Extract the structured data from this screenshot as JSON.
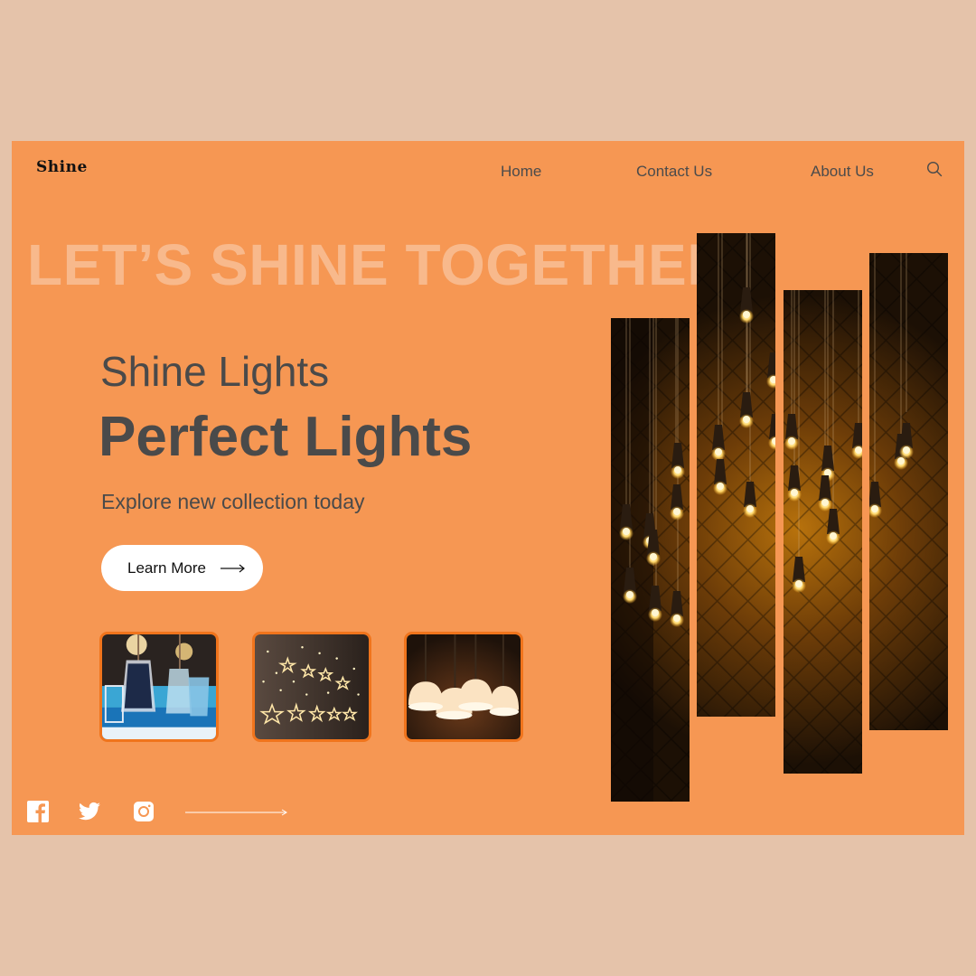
{
  "header": {
    "logo": "Shine",
    "nav": [
      {
        "label": "Home"
      },
      {
        "label": "Contact Us"
      },
      {
        "label": "About Us"
      }
    ],
    "search_icon": "search-icon"
  },
  "hero": {
    "banner": "LET’S SHINE TOGETHER",
    "subtitle": "Shine Lights",
    "headline": "Perfect Lights",
    "tagline": "Explore new collection today",
    "cta_label": "Learn More"
  },
  "thumbnails": [
    {
      "subject": "hanging lanterns"
    },
    {
      "subject": "star curtain lights"
    },
    {
      "subject": "pendant dome lamps"
    }
  ],
  "gallery": {
    "subject": "hanging pendant bulbs against diamond-patterned wall",
    "strips": 4
  },
  "social": [
    {
      "icon": "facebook-icon"
    },
    {
      "icon": "twitter-icon"
    },
    {
      "icon": "instagram-icon"
    }
  ],
  "colors": {
    "page_background": "#e5c3aa",
    "card_background": "#f69753",
    "banner_text": "#f8b98c",
    "body_text": "#4a4a4a",
    "thumb_border": "#f0741c",
    "button_background": "#ffffff"
  }
}
